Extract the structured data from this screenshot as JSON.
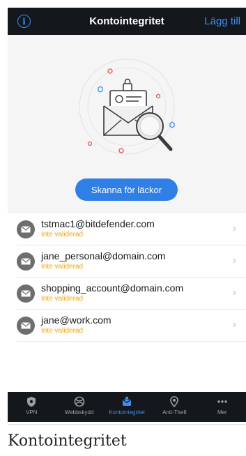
{
  "header": {
    "title": "Kontointegritet",
    "add_label": "Lägg till",
    "info_glyph": "i"
  },
  "hero": {
    "scan_button_label": "Skanna för läckor"
  },
  "accounts": [
    {
      "email": "tstmac1@bitdefender.com",
      "status": "Inte validerad"
    },
    {
      "email": "jane_personal@domain.com",
      "status": "Inte validerad"
    },
    {
      "email": "shopping_account@domain.com",
      "status": "Inte validerad"
    },
    {
      "email": "jane@work.com",
      "status": "Inte validerad"
    }
  ],
  "tabbar": {
    "items": [
      {
        "label": "VPN",
        "icon": "vpn-shield-icon"
      },
      {
        "label": "Webbskydd",
        "icon": "web-protection-icon"
      },
      {
        "label": "Kontointegritet",
        "icon": "account-privacy-icon",
        "active": true
      },
      {
        "label": "Anti-Theft",
        "icon": "anti-theft-icon"
      },
      {
        "label": "Mer",
        "icon": "more-icon"
      }
    ]
  },
  "caption": "Kontointegritet",
  "colors": {
    "accent": "#2f7fe6",
    "warning": "#f0a30a",
    "dark_bar": "#14181c"
  }
}
